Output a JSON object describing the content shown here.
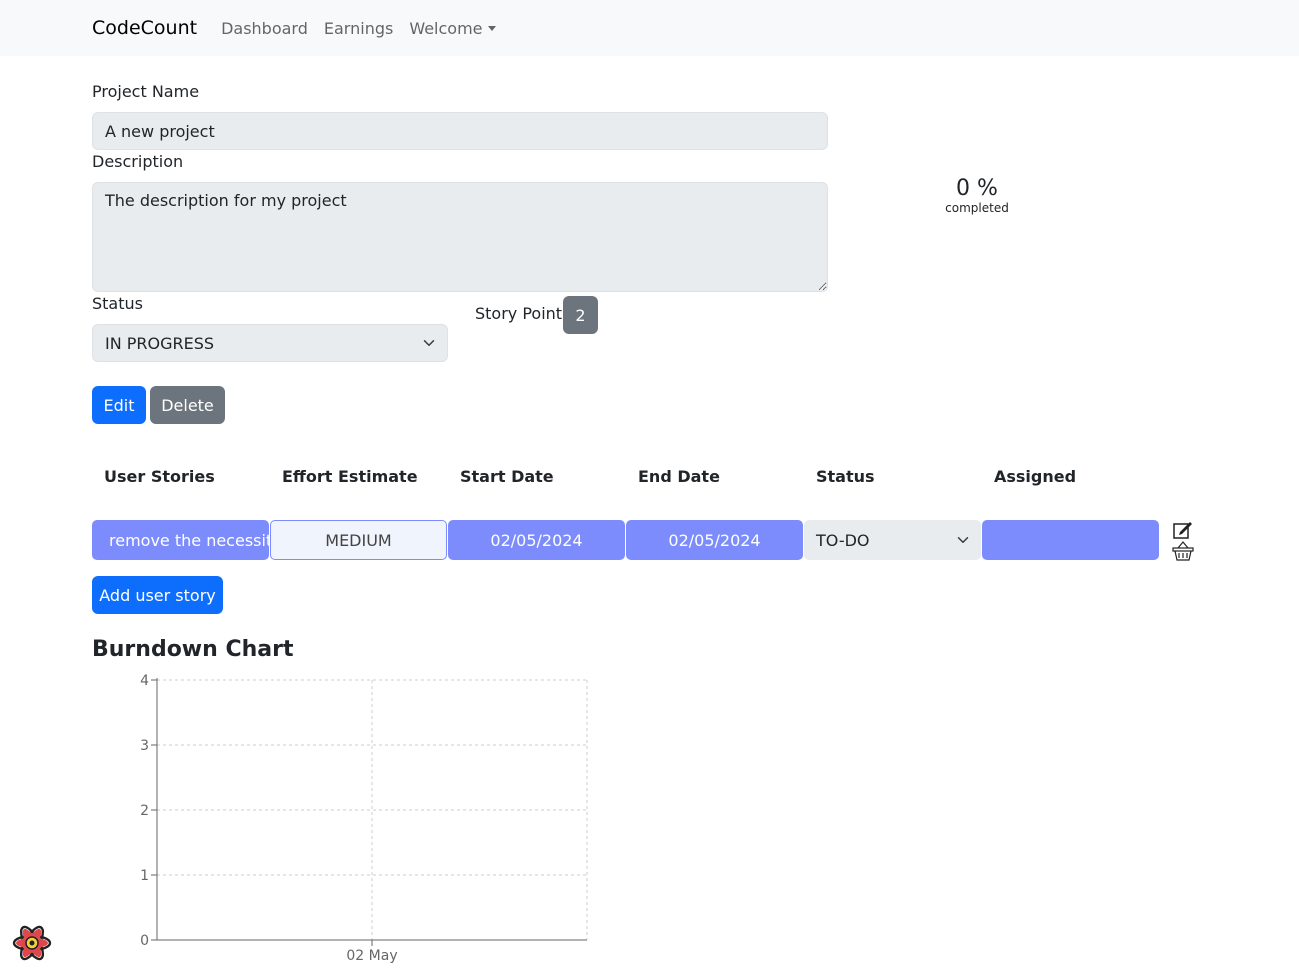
{
  "navbar": {
    "brand": "CodeCount",
    "links": [
      "Dashboard",
      "Earnings"
    ],
    "dropdown": "Welcome"
  },
  "form": {
    "project_name_label": "Project Name",
    "project_name_value": "A new project",
    "description_label": "Description",
    "description_value": "The description for my project",
    "status_label": "Status",
    "status_value": "IN PROGRESS",
    "story_points_label": "Story Points",
    "story_points_value": "2",
    "edit_label": "Edit",
    "delete_label": "Delete"
  },
  "progress": {
    "percent_text": "0 %",
    "caption": "completed"
  },
  "stories": {
    "headers": [
      "User Stories",
      "Effort Estimate",
      "Start Date",
      "End Date",
      "Status",
      "Assigned"
    ],
    "rows": [
      {
        "story": "remove the necessity",
        "effort": "MEDIUM",
        "start": "02/05/2024",
        "end": "02/05/2024",
        "status": "TO-DO",
        "assigned": ""
      }
    ],
    "add_label": "Add user story"
  },
  "icons": {
    "edit": "edit-icon",
    "delete": "basket-icon",
    "dropdown": "chevron-down-icon",
    "devtools": "react-logo-icon"
  },
  "colors": {
    "primary": "#0d6efd",
    "secondary": "#6c757d",
    "story_cell": "#7c8cfc",
    "input_bg": "#e9ecef"
  },
  "chart": {
    "title": "Burndown Chart"
  },
  "chart_data": {
    "type": "line",
    "title": "Burndown Chart",
    "categories": [
      "02 May"
    ],
    "series": [],
    "y_ticks": [
      0,
      1,
      2,
      3,
      4
    ],
    "ylim": [
      0,
      4
    ],
    "grid": true,
    "xlabel": "",
    "ylabel": ""
  }
}
